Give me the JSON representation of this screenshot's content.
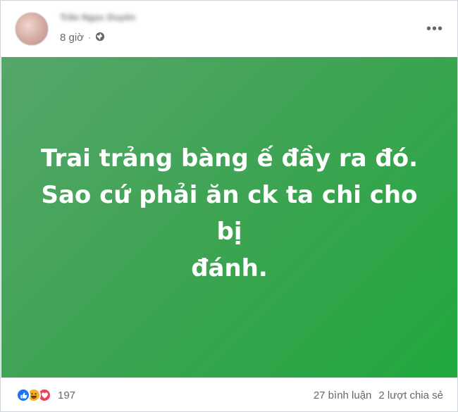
{
  "post": {
    "author": {
      "name": "Trần Ngọc Duyên"
    },
    "timestamp": "8 giờ",
    "separator": "·",
    "privacy_icon": "globe-icon",
    "more_icon": "more-options-icon",
    "more_label": "•••",
    "background": {
      "gradient": [
        "#55a66a",
        "#20a83f"
      ]
    },
    "text_lines": [
      "Trai trảng bàng ế đầy ra đó.",
      "Sao cứ phải ăn ck ta chi cho bị",
      "đánh."
    ]
  },
  "footer": {
    "reaction_icons": [
      "like-icon",
      "haha-icon",
      "love-icon"
    ],
    "reaction_count": "197",
    "comments": "27 bình luận",
    "shares": "2 lượt chia sẻ"
  },
  "colors": {
    "like": "#1877f2",
    "haha": "#f7b125",
    "love": "#f33e58",
    "secondary_text": "#65676b"
  }
}
